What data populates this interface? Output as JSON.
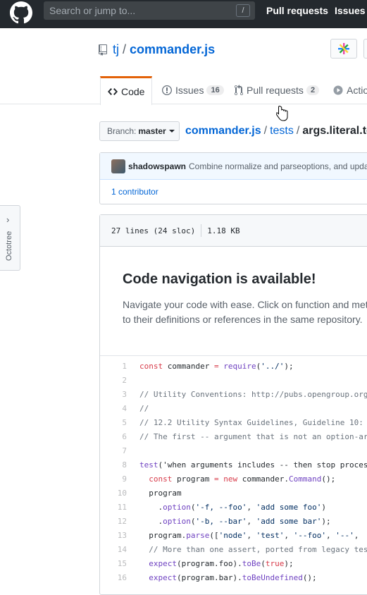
{
  "topbar": {
    "search_placeholder": "Search or jump to...",
    "slash_key": "/",
    "nav": [
      "Pull requests",
      "Issues"
    ]
  },
  "repo": {
    "owner": "tj",
    "separator": "/",
    "name": "commander.js"
  },
  "tabs": [
    {
      "label": "Code",
      "icon": "code-icon",
      "selected": true
    },
    {
      "label": "Issues",
      "icon": "issue-icon",
      "count": "16"
    },
    {
      "label": "Pull requests",
      "icon": "pull-request-icon",
      "count": "2"
    },
    {
      "label": "Actio",
      "icon": "play-icon"
    }
  ],
  "branch": {
    "label": "Branch:",
    "value": "master"
  },
  "breadcrumb": {
    "root": "commander.js",
    "sep": "/",
    "dir": "tests",
    "file": "args.literal.te"
  },
  "commit": {
    "author": "shadowspawn",
    "message": "Combine normalize and parseoptions, and update",
    "contributors": "1 contributor"
  },
  "octotree": {
    "label": "Octotree"
  },
  "file": {
    "lines_info": "27 lines (24 sloc)",
    "size": "1.18 KB"
  },
  "code_nav": {
    "title": "Code navigation is available!",
    "text_line1": "Navigate your code with ease. Click on function and met",
    "text_line2": "to their definitions or references in the same repository."
  },
  "code_lines": [
    {
      "n": "1",
      "text": "const commander = require('../');"
    },
    {
      "n": "2",
      "text": ""
    },
    {
      "n": "3",
      "text": "// Utility Conventions: http://pubs.opengroup.org"
    },
    {
      "n": "4",
      "text": "//"
    },
    {
      "n": "5",
      "text": "// 12.2 Utility Syntax Guidelines, Guideline 10:"
    },
    {
      "n": "6",
      "text": "// The first -- argument that is not an option-ar"
    },
    {
      "n": "7",
      "text": ""
    },
    {
      "n": "8",
      "text": "test('when arguments includes -- then stop proces"
    },
    {
      "n": "9",
      "text": "  const program = new commander.Command();"
    },
    {
      "n": "10",
      "text": "  program"
    },
    {
      "n": "11",
      "text": "    .option('-f, --foo', 'add some foo')"
    },
    {
      "n": "12",
      "text": "    .option('-b, --bar', 'add some bar');"
    },
    {
      "n": "13",
      "text": "  program.parse(['node', 'test', '--foo', '--',"
    },
    {
      "n": "14",
      "text": "  // More than one assert, ported from legacy tes"
    },
    {
      "n": "15",
      "text": "  expect(program.foo).toBe(true);"
    },
    {
      "n": "16",
      "text": "  expect(program.bar).toBeUndefined();"
    }
  ]
}
